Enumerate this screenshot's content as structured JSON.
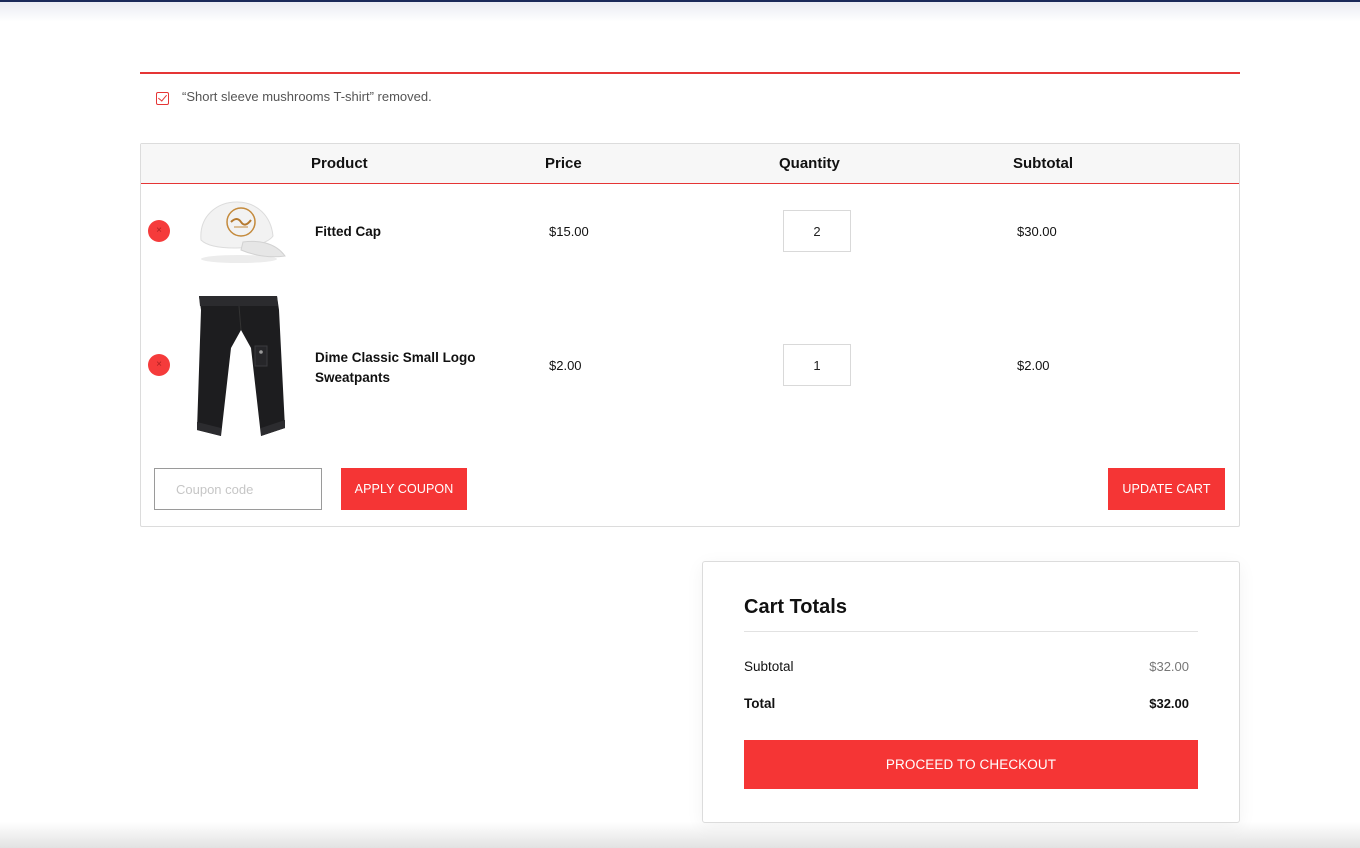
{
  "notice": {
    "message": "“Short sleeve mushrooms T-shirt” removed."
  },
  "table": {
    "headers": {
      "product": "Product",
      "price": "Price",
      "quantity": "Quantity",
      "subtotal": "Subtotal"
    },
    "rows": [
      {
        "name": "Fitted Cap",
        "price": "$15.00",
        "quantity": "2",
        "subtotal": "$30.00",
        "image_icon": "cap-image",
        "remove_icon": "close-icon"
      },
      {
        "name": "Dime Classic Small Logo Sweatpants",
        "price": "$2.00",
        "quantity": "1",
        "subtotal": "$2.00",
        "image_icon": "sweatpants-image",
        "remove_icon": "close-icon"
      }
    ],
    "remove_glyph": "×"
  },
  "actions": {
    "coupon_placeholder": "Coupon code",
    "apply_coupon_label": "APPLY COUPON",
    "update_cart_label": "UPDATE CART"
  },
  "totals": {
    "title": "Cart Totals",
    "subtotal_label": "Subtotal",
    "subtotal_value": "$32.00",
    "total_label": "Total",
    "total_value": "$32.00",
    "checkout_label": "PROCEED TO CHECKOUT"
  },
  "colors": {
    "accent": "#f53535",
    "header_bg": "#f7f7f7",
    "border": "#dcdcdc",
    "top_bar": "#1b2a5a"
  }
}
